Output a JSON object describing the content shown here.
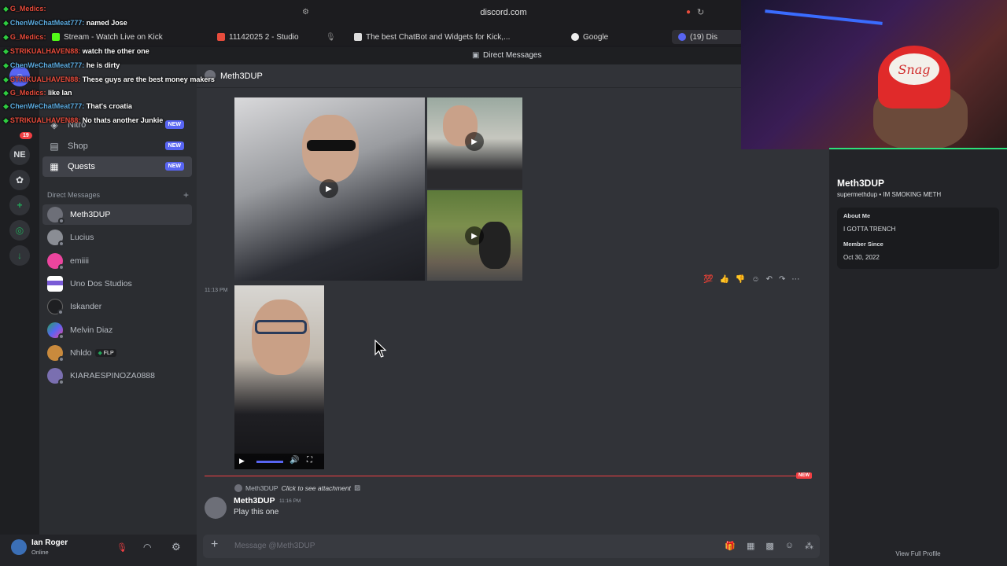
{
  "browser": {
    "url": "discord.com",
    "tabs": [
      {
        "label": "Stream - Watch Live on Kick"
      },
      {
        "label": "11142025 2 - Studio"
      },
      {
        "label": "The best ChatBot and Widgets for Kick,..."
      },
      {
        "label": "Google"
      },
      {
        "label": "(19) Dis"
      }
    ]
  },
  "discord": {
    "window_title": "Direct Messages",
    "rail": {
      "badge_count": "19",
      "server_initials": "NE"
    },
    "nav": [
      {
        "label": "Nitro",
        "badge": "NEW"
      },
      {
        "label": "Shop",
        "badge": "NEW"
      },
      {
        "label": "Quests",
        "badge": "NEW"
      }
    ],
    "dm_header": "Direct Messages",
    "dms": [
      {
        "name": "Meth3DUP"
      },
      {
        "name": "Lucius"
      },
      {
        "name": "emiiii"
      },
      {
        "name": "Uno Dos Studios"
      },
      {
        "name": "Iskander"
      },
      {
        "name": "Melvin Diaz"
      },
      {
        "name": "Nhldo",
        "tag": "FLP"
      },
      {
        "name": "KIARAESPINOZA0888"
      }
    ],
    "user": {
      "name": "Ian Roger",
      "status": "Online"
    },
    "channel": {
      "name": "Meth3DUP"
    },
    "messages": {
      "timestamp_1": "11:13 PM",
      "new_label": "NEW",
      "reply_author": "Meth3DUP",
      "reply_text": "Click to see attachment",
      "author": "Meth3DUP",
      "time": "11:16 PM",
      "text": "Play this one"
    },
    "composer": {
      "placeholder": "Message @Meth3DUP"
    },
    "profile": {
      "name": "Meth3DUP",
      "handle_line": "supermethdup • IM SMOKING METH",
      "about_label": "About Me",
      "about_text": "I GOTTA TRENCH",
      "member_label": "Member Since",
      "member_date": "Oct 30, 2022",
      "view_full": "View Full Profile"
    }
  },
  "stream_chat": [
    {
      "user": "G_Medics",
      "text": "",
      "color": "#e74c3c"
    },
    {
      "user": "ChenWeChatMeat777",
      "text": "named Jose",
      "color": "#5dade2"
    },
    {
      "user": "G_Medics",
      "text": "",
      "color": "#e74c3c"
    },
    {
      "user": "STRIKUALHAVEN88",
      "text": "watch the other one",
      "color": "#e74c3c"
    },
    {
      "user": "ChenWeChatMeat777",
      "text": "he is dirty",
      "color": "#5dade2"
    },
    {
      "user": "STRIKUALHAVEN88",
      "text": "These guys are the best money makers",
      "color": "#e74c3c"
    },
    {
      "user": "G_Medics",
      "text": "like Ian",
      "color": "#e74c3c"
    },
    {
      "user": "ChenWeChatMeat777",
      "text": "That's croatia",
      "color": "#5dade2"
    },
    {
      "user": "STRIKUALHAVEN88",
      "text": "No thats another Junkie",
      "color": "#e74c3c"
    }
  ],
  "webcam": {
    "hat_text": "Snag"
  },
  "colors": {
    "accent": "#5865f2",
    "new_red": "#f23f43",
    "online": "#23a559"
  }
}
